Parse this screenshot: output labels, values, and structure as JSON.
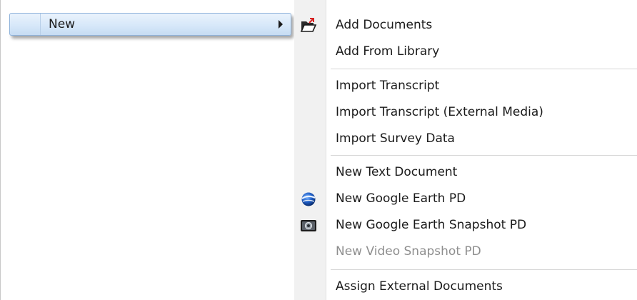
{
  "parent_menu": {
    "selected_item": {
      "label": "New",
      "has_submenu": true,
      "arrow_icon": "chevron-right-icon"
    }
  },
  "submenu": {
    "items": [
      {
        "label": "Add Documents",
        "icon": "open-folder-icon",
        "enabled": true
      },
      {
        "label": "Add From Library",
        "icon": null,
        "enabled": true
      },
      {
        "label": "Import Transcript",
        "icon": null,
        "enabled": true
      },
      {
        "label": "Import Transcript (External Media)",
        "icon": null,
        "enabled": true
      },
      {
        "label": "Import Survey Data",
        "icon": null,
        "enabled": true
      },
      {
        "label": "New Text Document",
        "icon": null,
        "enabled": true
      },
      {
        "label": "New Google Earth PD",
        "icon": "google-earth-globe-icon",
        "enabled": true
      },
      {
        "label": "New Google Earth Snapshot PD",
        "icon": "camera-snapshot-icon",
        "enabled": true
      },
      {
        "label": "New Video Snapshot PD",
        "icon": null,
        "enabled": false
      },
      {
        "label": "Assign External Documents",
        "icon": null,
        "enabled": true
      }
    ]
  },
  "colors": {
    "highlight_top": "#eaf3fc",
    "highlight_bottom": "#c6dcf3",
    "highlight_border": "#8fb3db",
    "gutter": "#f1f1f1",
    "separator": "#d6d6d6",
    "disabled_text": "#8e8e8e"
  }
}
